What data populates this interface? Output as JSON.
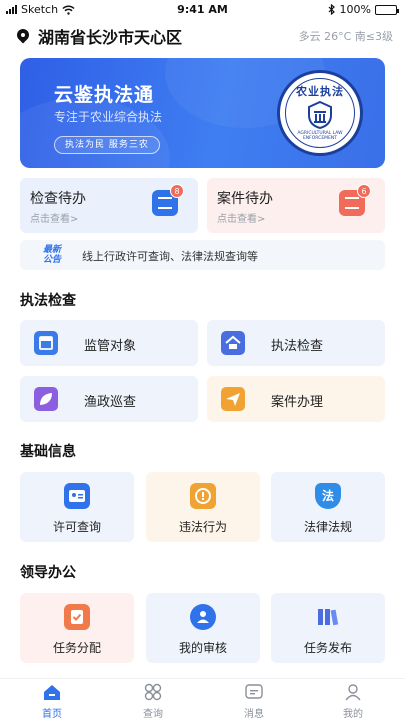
{
  "status_bar": {
    "carrier": "Sketch",
    "time": "9:41 AM",
    "battery": "100%",
    "battery_level": 1.0
  },
  "location": {
    "text": "湖南省长沙市天心区",
    "weather": "多云 26°C 南≤3级"
  },
  "banner": {
    "title": "云鉴执法通",
    "subtitle": "专注于农业综合执法",
    "tag": "执法为民 服务三农",
    "emblem_top": "农业执法",
    "emblem_ring": "AGRICULTURAL LAW ENFORCEMENT"
  },
  "todos": [
    {
      "title": "检查待办",
      "sub": "点击查看>",
      "badge": "8"
    },
    {
      "title": "案件待办",
      "sub": "点击查看>",
      "badge": "6"
    }
  ],
  "notice": {
    "tag_line1": "最新",
    "tag_line2": "公告",
    "text": "线上行政许可查询、法律法规查询等"
  },
  "sections": {
    "enforcement": {
      "title": "执法检查",
      "items": [
        {
          "label": "监管对象",
          "icon": "building-icon",
          "color": "#3a7be8"
        },
        {
          "label": "执法检查",
          "icon": "house-icon",
          "color": "#4a6ee0"
        },
        {
          "label": "渔政巡查",
          "icon": "leaf-icon",
          "color": "#8b5fe0"
        },
        {
          "label": "案件办理",
          "icon": "send-icon",
          "color": "#f0a232"
        }
      ]
    },
    "basic": {
      "title": "基础信息",
      "items": [
        {
          "label": "许可查询",
          "icon": "id-card-icon",
          "color": "#2f72ea"
        },
        {
          "label": "违法行为",
          "icon": "violation-icon",
          "color": "#f0a232"
        },
        {
          "label": "法律法规",
          "icon": "law-shield-icon",
          "color": "#2f8de8",
          "glyph": "法"
        }
      ]
    },
    "leader": {
      "title": "领导办公",
      "items": [
        {
          "label": "任务分配",
          "icon": "clipboard-check-icon",
          "color": "#f07a4a"
        },
        {
          "label": "我的审核",
          "icon": "reviewer-icon",
          "color": "#2f72ea"
        },
        {
          "label": "任务发布",
          "icon": "books-icon",
          "color": "#4a6ee0"
        }
      ]
    }
  },
  "tabbar": [
    {
      "label": "首页",
      "icon": "home-icon",
      "active": true
    },
    {
      "label": "查询",
      "icon": "grid-icon",
      "active": false
    },
    {
      "label": "消息",
      "icon": "message-icon",
      "active": false
    },
    {
      "label": "我的",
      "icon": "profile-icon",
      "active": false
    }
  ]
}
